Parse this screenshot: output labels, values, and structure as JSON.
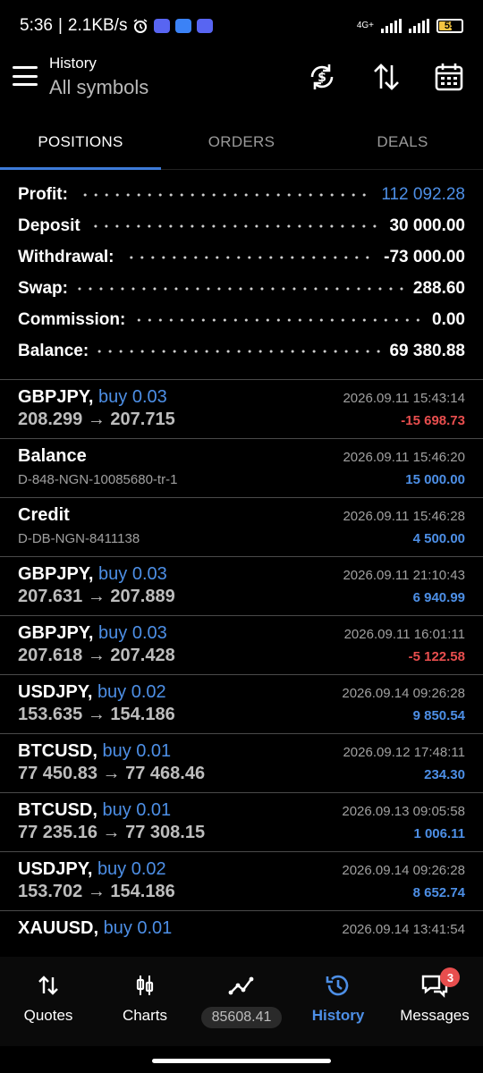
{
  "status_bar": {
    "time": "5:36",
    "separator": "|",
    "speed": "2.1KB/s",
    "network": "4G+",
    "battery": "55"
  },
  "header": {
    "title_small": "History",
    "title_big": "All symbols",
    "icons": [
      "menu-icon",
      "sync-currency-icon",
      "sort-icon",
      "calendar-icon"
    ]
  },
  "tabs": [
    {
      "label": "POSITIONS",
      "active": true
    },
    {
      "label": "ORDERS",
      "active": false
    },
    {
      "label": "DEALS",
      "active": false
    }
  ],
  "summary": {
    "profit": {
      "label": "Profit:",
      "value": "112 092.28"
    },
    "deposit": {
      "label": "Deposit",
      "value": "30 000.00"
    },
    "withdrawal": {
      "label": "Withdrawal:",
      "value": "-73 000.00"
    },
    "swap": {
      "label": "Swap:",
      "value": "288.60"
    },
    "commission": {
      "label": "Commission:",
      "value": "0.00"
    },
    "balance": {
      "label": "Balance:",
      "value": "69 380.88"
    }
  },
  "rows": [
    {
      "symbol": "GBPJPY,",
      "side": "buy 0.03",
      "prices": "208.299 → 207.715",
      "time": "2026.09.11 15:43:14",
      "pl": "-15 698.73",
      "sign": "neg"
    },
    {
      "symbol": "Balance",
      "side": "",
      "sub": "D-848-NGN-10085680-tr-1",
      "time": "2026.09.11 15:46:20",
      "pl": "15 000.00",
      "sign": "pos"
    },
    {
      "symbol": "Credit",
      "side": "",
      "sub": "D-DB-NGN-8411138",
      "time": "2026.09.11 15:46:28",
      "pl": "4 500.00",
      "sign": "pos"
    },
    {
      "symbol": "GBPJPY,",
      "side": "buy 0.03",
      "prices": "207.631 → 207.889",
      "time": "2026.09.11 21:10:43",
      "pl": "6 940.99",
      "sign": "pos"
    },
    {
      "symbol": "GBPJPY,",
      "side": "buy 0.03",
      "prices": "207.618 → 207.428",
      "time": "2026.09.11 16:01:11",
      "pl": "-5 122.58",
      "sign": "neg"
    },
    {
      "symbol": "USDJPY,",
      "side": "buy 0.02",
      "prices": "153.635 → 154.186",
      "time": "2026.09.14 09:26:28",
      "pl": "9 850.54",
      "sign": "pos"
    },
    {
      "symbol": "BTCUSD,",
      "side": "buy 0.01",
      "prices": "77 450.83 → 77 468.46",
      "time": "2026.09.12 17:48:11",
      "pl": "234.30",
      "sign": "pos"
    },
    {
      "symbol": "BTCUSD,",
      "side": "buy 0.01",
      "prices": "77 235.16 → 77 308.15",
      "time": "2026.09.13 09:05:58",
      "pl": "1 006.11",
      "sign": "pos"
    },
    {
      "symbol": "USDJPY,",
      "side": "buy 0.02",
      "prices": "153.702 → 154.186",
      "time": "2026.09.14 09:26:28",
      "pl": "8 652.74",
      "sign": "pos"
    },
    {
      "symbol": "XAUUSD,",
      "side": "buy 0.01",
      "prices": "",
      "time": "2026.09.14 13:41:54",
      "pl": "",
      "sign": "pos"
    }
  ],
  "bottom_nav": {
    "quotes": "Quotes",
    "charts": "Charts",
    "balance_pill": "85608.41",
    "history": "History",
    "messages": "Messages",
    "messages_badge": "3"
  },
  "colors": {
    "accent": "#4d8fe6",
    "negative": "#e84e4e",
    "background": "#000000"
  }
}
